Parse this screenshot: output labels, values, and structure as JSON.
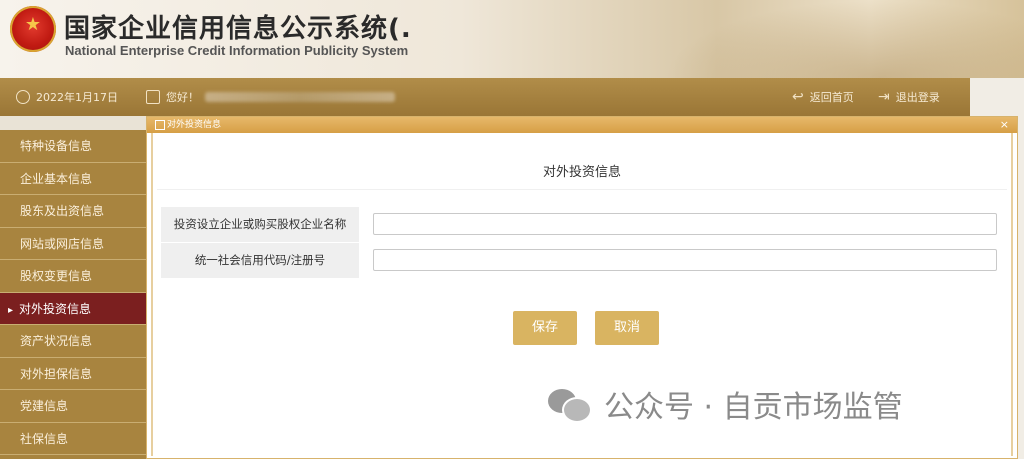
{
  "header": {
    "title_zh": "国家企业信用信息公示系统(.",
    "title_en": "National Enterprise Credit Information Publicity System"
  },
  "topbar": {
    "date": "2022年1月17日",
    "greeting": "您好！",
    "back_home": "返回首页",
    "logout": "退出登录"
  },
  "sidebar": {
    "items": [
      {
        "label": "特种设备信息"
      },
      {
        "label": "企业基本信息"
      },
      {
        "label": "股东及出资信息"
      },
      {
        "label": "网站或网店信息"
      },
      {
        "label": "股权变更信息"
      },
      {
        "label": "对外投资信息",
        "active": true
      },
      {
        "label": "资产状况信息"
      },
      {
        "label": "对外担保信息"
      },
      {
        "label": "党建信息"
      },
      {
        "label": "社保信息"
      }
    ]
  },
  "dialog": {
    "title": "对外投资信息",
    "heading": "对外投资信息",
    "fields": [
      {
        "label": "投资设立企业或购买股权企业名称",
        "value": ""
      },
      {
        "label": "统一社会信用代码/注册号",
        "value": ""
      }
    ],
    "save_label": "保存",
    "cancel_label": "取消",
    "close_symbol": "×"
  },
  "watermark": {
    "text": "公众号 · 自贡市场监管"
  },
  "colors": {
    "accent": "#d9b461",
    "sidebar": "#a8843f",
    "sidebar_active": "#7b1f1f"
  }
}
